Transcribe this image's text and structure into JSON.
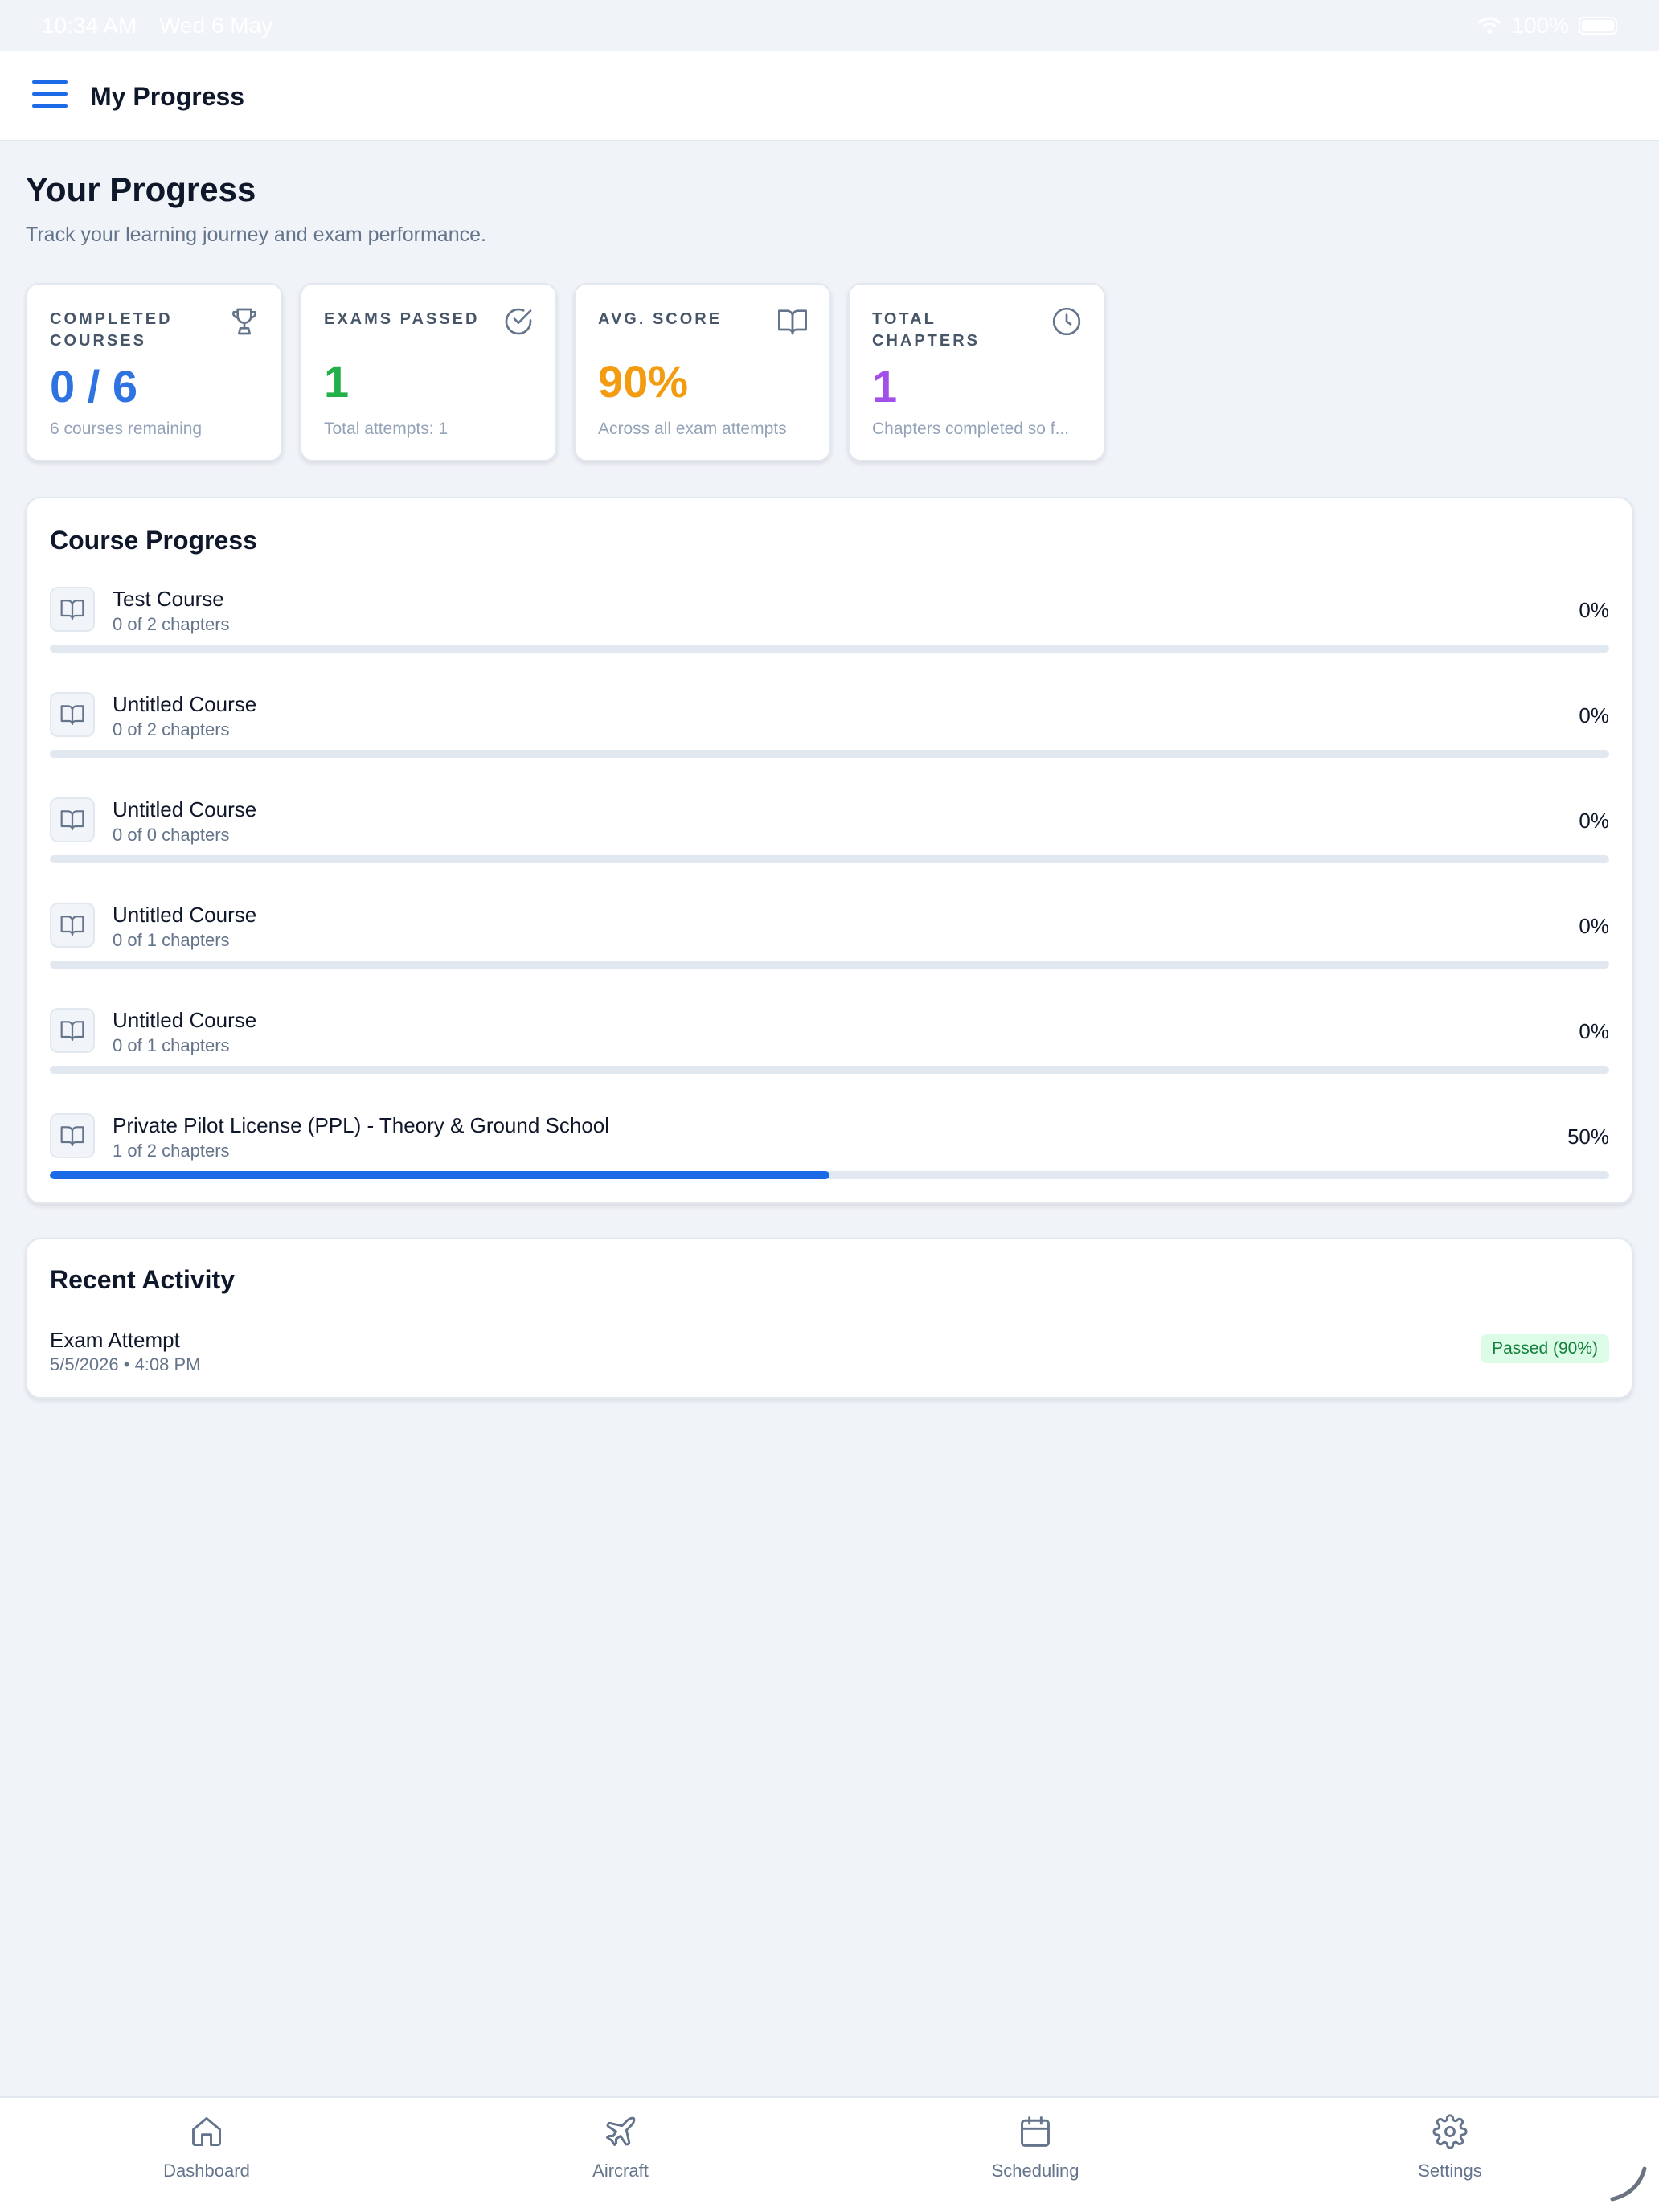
{
  "status_bar": {
    "time": "10:34 AM",
    "date": "Wed 6 May",
    "battery": "100%"
  },
  "appbar": {
    "title": "My Progress"
  },
  "header": {
    "title": "Your Progress",
    "subtitle": "Track your learning journey and exam performance."
  },
  "stats": [
    {
      "label": "COMPLETED COURSES",
      "value": "0 / 6",
      "sub": "6 courses remaining",
      "icon": "trophy-icon",
      "color": "#2f73e0"
    },
    {
      "label": "EXAMS PASSED",
      "value": "1",
      "sub": "Total attempts: 1",
      "icon": "check-circle-icon",
      "color": "#22b04b"
    },
    {
      "label": "AVG. SCORE",
      "value": "90%",
      "sub": "Across all exam attempts",
      "icon": "book-open-icon",
      "color": "#f39c12"
    },
    {
      "label": "TOTAL CHAPTERS",
      "value": "1",
      "sub": "Chapters completed so f...",
      "icon": "clock-icon",
      "color": "#a350e8"
    }
  ],
  "course_progress": {
    "title": "Course Progress",
    "courses": [
      {
        "name": "Test Course",
        "meta": "0 of 2 chapters",
        "percent_label": "0%",
        "progress": 0
      },
      {
        "name": "Untitled Course",
        "meta": "0 of 2 chapters",
        "percent_label": "0%",
        "progress": 0
      },
      {
        "name": "Untitled Course",
        "meta": "0 of 0 chapters",
        "percent_label": "0%",
        "progress": 0
      },
      {
        "name": "Untitled Course",
        "meta": "0 of 1 chapters",
        "percent_label": "0%",
        "progress": 0
      },
      {
        "name": "Untitled Course",
        "meta": "0 of 1 chapters",
        "percent_label": "0%",
        "progress": 0
      },
      {
        "name": "Private Pilot License (PPL) - Theory & Ground School",
        "meta": "1 of 2 chapters",
        "percent_label": "50%",
        "progress": 0.5
      }
    ]
  },
  "recent_activity": {
    "title": "Recent Activity",
    "items": [
      {
        "name": "Exam Attempt",
        "time": "5/5/2026 • 4:08 PM",
        "badge": "Passed (90%)"
      }
    ]
  },
  "bottom_nav": [
    {
      "label": "Dashboard",
      "icon": "home-icon"
    },
    {
      "label": "Aircraft",
      "icon": "plane-icon"
    },
    {
      "label": "Scheduling",
      "icon": "calendar-icon"
    },
    {
      "label": "Settings",
      "icon": "gear-icon"
    }
  ],
  "colors": {
    "accent": "#1d6ae6",
    "background": "#f0f3f8",
    "passed_bg": "#dcfce7",
    "passed_text": "#15803d"
  }
}
